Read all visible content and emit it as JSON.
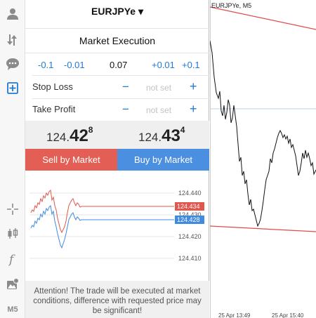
{
  "toolbar": {
    "items": [
      {
        "icon": "user-icon"
      },
      {
        "icon": "transfer-arrows-icon"
      },
      {
        "icon": "chat-icon"
      },
      {
        "icon": "new-order-icon",
        "active": true
      },
      {
        "icon": "crosshair-icon"
      },
      {
        "icon": "candlestick-icon"
      },
      {
        "icon": "function-icon"
      },
      {
        "icon": "image-objects-icon"
      }
    ],
    "timeframe": "M5"
  },
  "order": {
    "symbol": "EURJPYe ▾",
    "execution": "Market Execution",
    "steps": {
      "minus_large": "-0.1",
      "minus_small": "-0.01",
      "volume": "0.07",
      "plus_small": "+0.01",
      "plus_large": "+0.1"
    },
    "stop_loss": {
      "label": "Stop Loss",
      "minus": "−",
      "value": "not set",
      "plus": "+"
    },
    "take_profit": {
      "label": "Take Profit",
      "minus": "−",
      "value": "not set",
      "plus": "+"
    },
    "bid": {
      "prefix": "124.",
      "big": "42",
      "sup": "8"
    },
    "ask": {
      "prefix": "124.",
      "big": "43",
      "sup": "4"
    },
    "sell_label": "Sell by Market",
    "buy_label": "Buy by Market",
    "notice": "Attention! The trade will be executed at market conditions, difference with requested price may be significant!",
    "colors": {
      "sell": "#e35f55",
      "buy": "#4a8fe0",
      "accent": "#1f7ad6"
    }
  },
  "tick_chart": {
    "levels": [
      "124.440",
      "124.430",
      "124.420",
      "124.410"
    ],
    "bid_label": "124.434",
    "ask_label": "124.428",
    "bid_color": "#e0574e",
    "ask_color": "#3f8be0"
  },
  "main_chart": {
    "title": "EURJPYe, M5",
    "x_labels": [
      "25 Apr 13:49",
      "25 Apr 15:40"
    ]
  }
}
